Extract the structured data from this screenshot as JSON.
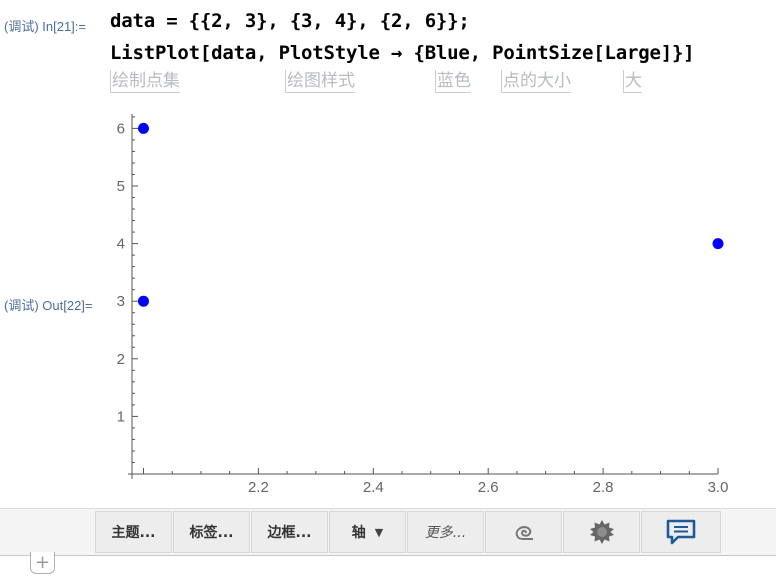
{
  "input_cell": {
    "label": "(调试) In[21]:=",
    "line1": "data = {{2, 3}, {3, 4}, {2, 6}};",
    "line2": "ListPlot[data, PlotStyle → {Blue, PointSize[Large]}]",
    "annotations": [
      "绘制点集",
      "绘图样式",
      "蓝色",
      "点的大小",
      "大"
    ]
  },
  "output_cell": {
    "label": "(调试) Out[22]="
  },
  "chart_data": {
    "type": "scatter",
    "points": [
      [
        2,
        3
      ],
      [
        3,
        4
      ],
      [
        2,
        6
      ]
    ],
    "xlim": [
      1.98,
      3.0
    ],
    "ylim": [
      0,
      6.25
    ],
    "xticks": [
      "2.2",
      "2.4",
      "2.6",
      "2.8",
      "3.0"
    ],
    "xtick_values": [
      2.2,
      2.4,
      2.6,
      2.8,
      3.0
    ],
    "yticks": [
      "1",
      "2",
      "3",
      "4",
      "5",
      "6"
    ],
    "ytick_values": [
      1,
      2,
      3,
      4,
      5,
      6
    ],
    "point_color": "#0000ff",
    "axis_color": "#555555",
    "grid": false
  },
  "toolbar": {
    "theme_label": "主题...",
    "labels_label": "标签...",
    "frame_label": "边框...",
    "axes_label": "轴",
    "more_label": "更多...",
    "icons": [
      "spiral-icon",
      "gear-icon",
      "chat-icon"
    ]
  },
  "plus_label": "+"
}
